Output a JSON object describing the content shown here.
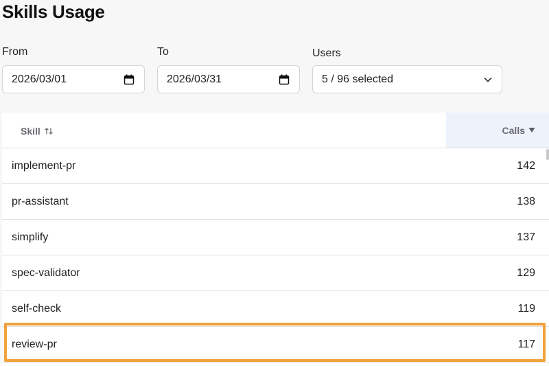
{
  "page": {
    "title": "Skills Usage"
  },
  "filters": {
    "from": {
      "label": "From",
      "value": "2026/03/01"
    },
    "to": {
      "label": "To",
      "value": "2026/03/31"
    },
    "users": {
      "label": "Users",
      "value": "5 / 96 selected"
    }
  },
  "table": {
    "columns": {
      "skill": "Skill",
      "calls": "Calls"
    },
    "sort": {
      "column": "calls",
      "direction": "descending"
    },
    "rows": [
      {
        "skill": "implement-pr",
        "calls": "142"
      },
      {
        "skill": "pr-assistant",
        "calls": "138"
      },
      {
        "skill": "simplify",
        "calls": "137"
      },
      {
        "skill": "spec-validator",
        "calls": "129"
      },
      {
        "skill": "self-check",
        "calls": "119"
      },
      {
        "skill": "review-pr",
        "calls": "117"
      }
    ],
    "highlighted_row": "review-pr"
  },
  "colors": {
    "highlight": "#f0a23a",
    "sorted_header_bg": "#eef3fb"
  },
  "icons": [
    "calendar-icon",
    "chevron-down-icon",
    "sort-toggle-icon",
    "sort-descending-icon"
  ]
}
